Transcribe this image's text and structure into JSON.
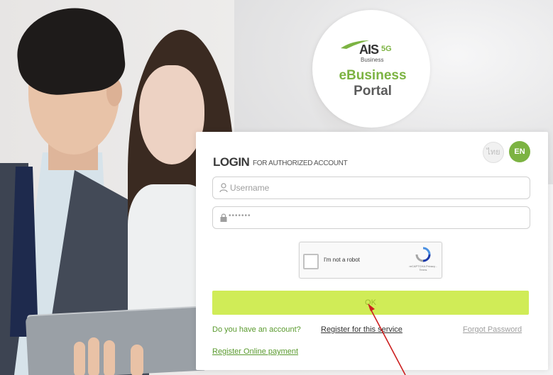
{
  "logo": {
    "brand": "AIS",
    "brand_suffix": "5G",
    "tagline": "Business",
    "product_line1": "eBusiness",
    "product_line2": "Portal"
  },
  "login": {
    "title": "LOGIN",
    "subtitle": "FOR AUTHORIZED ACCOUNT",
    "username_placeholder": "Username",
    "password_value": "•••••••",
    "ok_label": "OK"
  },
  "language": {
    "th_label": "ไทย",
    "en_label": "EN",
    "active": "EN"
  },
  "captcha": {
    "label": "I'm not a robot",
    "footer": "reCAPTCHA Privacy - Terms"
  },
  "links": {
    "account_question": "Do you have an account?",
    "register_service": "Register for this service",
    "forgot_password": "Forgot Password",
    "register_online_payment": "Register Online payment"
  },
  "colors": {
    "accent_green": "#7cb342",
    "ok_button": "#d0ec57",
    "annotation_arrow": "#cc1f1f"
  }
}
